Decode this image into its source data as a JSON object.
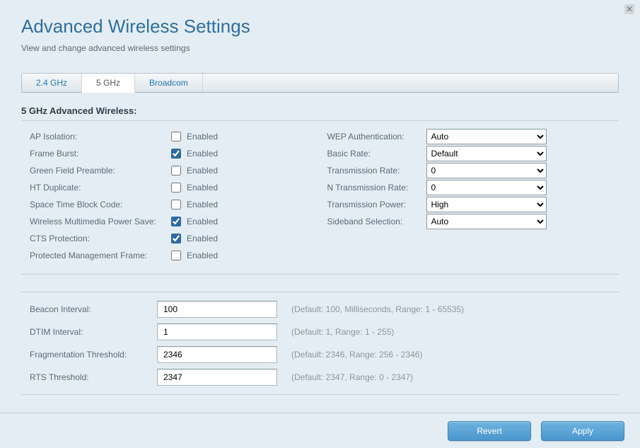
{
  "header": {
    "title": "Advanced Wireless Settings",
    "subtitle": "View and change advanced wireless settings"
  },
  "tabs": [
    {
      "label": "2.4 GHz",
      "active": false
    },
    {
      "label": "5 GHz",
      "active": true
    },
    {
      "label": "Broadcom",
      "active": false
    }
  ],
  "section_title": "5 GHz Advanced Wireless:",
  "enabled_text": "Enabled",
  "checkboxes": [
    {
      "label": "AP Isolation:",
      "checked": false
    },
    {
      "label": "Frame Burst:",
      "checked": true
    },
    {
      "label": "Green Field Preamble:",
      "checked": false
    },
    {
      "label": "HT Duplicate:",
      "checked": false
    },
    {
      "label": "Space Time Block Code:",
      "checked": false
    },
    {
      "label": "Wireless Multimedia Power Save:",
      "checked": true
    },
    {
      "label": "CTS Protection:",
      "checked": true
    },
    {
      "label": "Protected Management Frame:",
      "checked": false
    }
  ],
  "selects": [
    {
      "label": "WEP Authentication:",
      "value": "Auto"
    },
    {
      "label": "Basic Rate:",
      "value": "Default"
    },
    {
      "label": "Transmission Rate:",
      "value": "0"
    },
    {
      "label": "N Transmission Rate:",
      "value": "0"
    },
    {
      "label": "Transmission Power:",
      "value": "High"
    },
    {
      "label": "Sideband Selection:",
      "value": "Auto"
    }
  ],
  "inputs": [
    {
      "label": "Beacon Interval:",
      "value": "100",
      "hint": "(Default: 100, Milliseconds, Range: 1 - 65535)"
    },
    {
      "label": "DTIM Interval:",
      "value": "1",
      "hint": "(Default: 1, Range: 1 - 255)"
    },
    {
      "label": "Fragmentation Threshold:",
      "value": "2346",
      "hint": "(Default: 2346, Range: 256 - 2346)"
    },
    {
      "label": "RTS Threshold:",
      "value": "2347",
      "hint": "(Default: 2347, Range: 0 - 2347)"
    }
  ],
  "footer": {
    "revert": "Revert",
    "apply": "Apply"
  }
}
